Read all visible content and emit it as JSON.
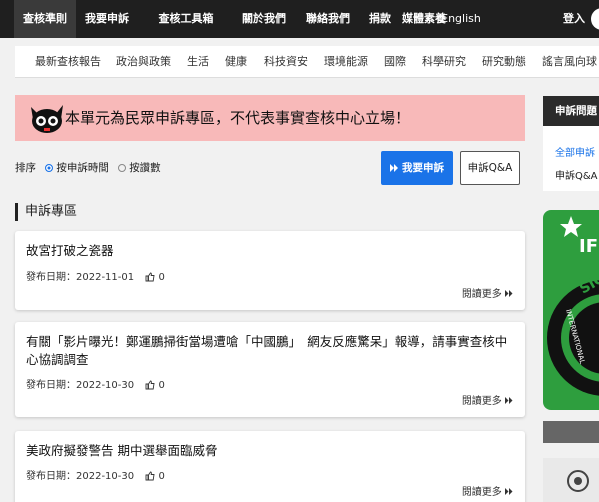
{
  "topnav": {
    "items": [
      "查核準則",
      "我要申訴",
      "查核工具箱",
      "關於我們",
      "聯絡我們",
      "捐款",
      "媒體素養",
      "English"
    ],
    "login": "登入"
  },
  "subnav": {
    "items": [
      "最新查核報告",
      "政治與政策",
      "生活",
      "健康",
      "科技資安",
      "環境能源",
      "國際",
      "科學研究",
      "研究動態",
      "謠言風向球"
    ]
  },
  "banner": {
    "text": "本單元為民眾申訴專區，不代表事實查核中心立場！"
  },
  "sort": {
    "label": "排序",
    "options": [
      "按申訴時間",
      "按讚數"
    ],
    "selected": "按申訴時間"
  },
  "buttons": {
    "complain": "我要申訴",
    "qa": "申訴Q&A"
  },
  "section_title": "申訴專區",
  "posts": [
    {
      "title": "故宮打破之瓷器",
      "date_label": "發布日期：",
      "date": "2022-11-01",
      "likes": "0",
      "read_more": "閱讀更多"
    },
    {
      "title": "有關「影片曝光！鄭運鵬掃街當場遭嗆「中國鵬」　網友反應驚呆」報導，請事實查核中心協調調查",
      "date_label": "發布日期：",
      "date": "2022-10-30",
      "likes": "0",
      "read_more": "閱讀更多"
    },
    {
      "title": "美政府擬發警告 期中選舉面臨威脅",
      "date_label": "發布日期：",
      "date": "2022-10-30",
      "likes": "0",
      "read_more": "閱讀更多"
    }
  ],
  "sidebar": {
    "title": "申訴問題",
    "links": [
      "全部申訴",
      "申訴Q&A"
    ],
    "badge_text": "IF",
    "badge_ring_text": "SIG",
    "badge_side_text": "INTERNATIONAL"
  },
  "colors": {
    "accent": "#1a73e8",
    "banner_bg": "#f8b9b9",
    "nav_bg": "#1f1f1f",
    "ifcn_green": "#2e9e3e"
  }
}
